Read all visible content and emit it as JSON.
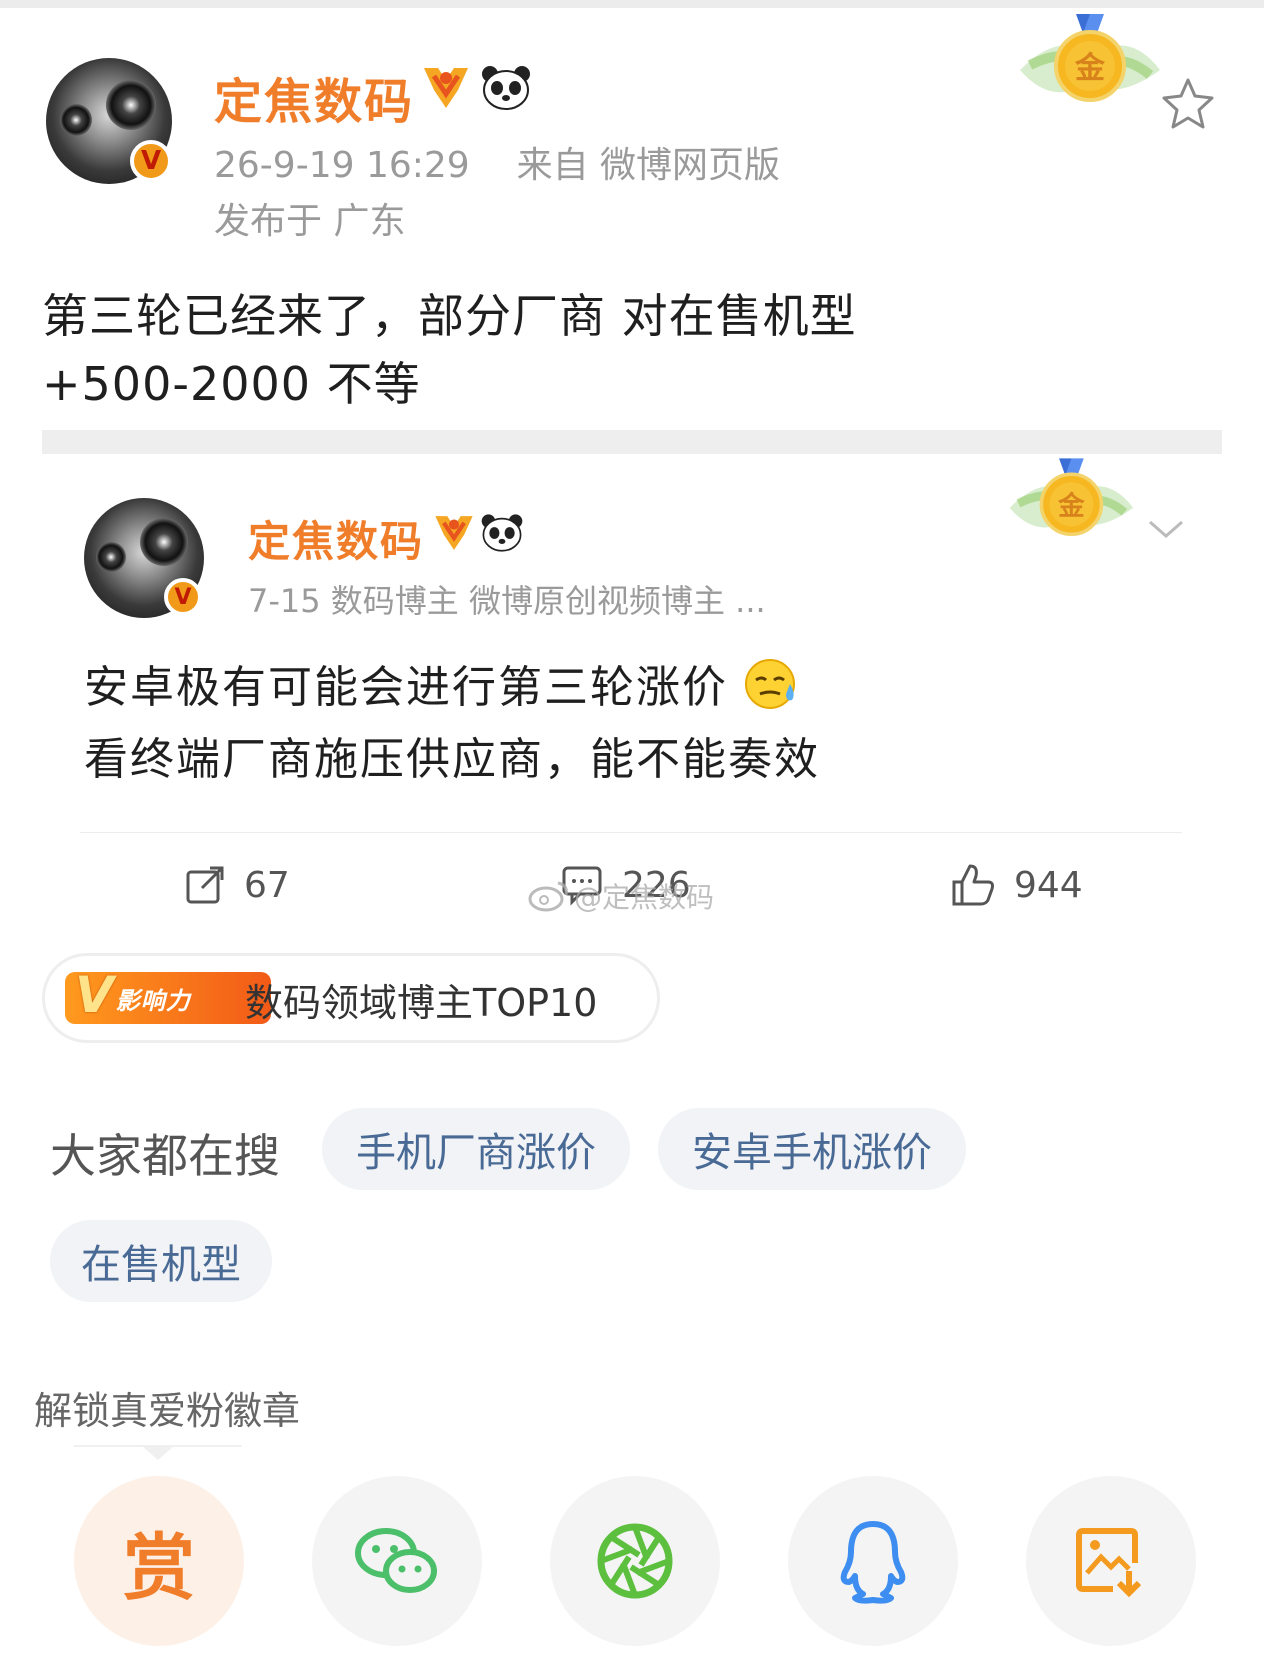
{
  "post": {
    "author": "定焦数码",
    "time": "26-9-19 16:29",
    "source": "来自 微博网页版",
    "location": "发布于 广东",
    "text_line1": "第三轮已经来了，部分厂商 对在售机型",
    "text_line2": "+500-2000 不等"
  },
  "repost": {
    "author": "定焦数码",
    "meta": "7-15 数码博主 微博原创视频博主 ...",
    "text_line1": "安卓极有可能会进行第三轮涨价",
    "text_line2": "看终端厂商施压供应商，能不能奏效",
    "actions": {
      "repost_count": "67",
      "comment_count": "226",
      "like_count": "944"
    },
    "watermark": "@定焦数码"
  },
  "influence": {
    "badge_v": "V",
    "badge_text": "影响力",
    "text": "数码领域博主TOP10"
  },
  "search": {
    "label": "大家都在搜",
    "chips": [
      "手机厂商涨价",
      "安卓手机涨价",
      "在售机型"
    ]
  },
  "unlock": {
    "label": "解锁真爱粉徽章"
  },
  "share": {
    "reward_label": "赏"
  },
  "medal_text": "金",
  "colors": {
    "username": "#f07d2a",
    "chip_text": "#4a6a96",
    "wechat": "#4cbf6a",
    "moments": "#5cbf3e",
    "qq": "#3d8ef0",
    "save": "#f39a1f"
  }
}
